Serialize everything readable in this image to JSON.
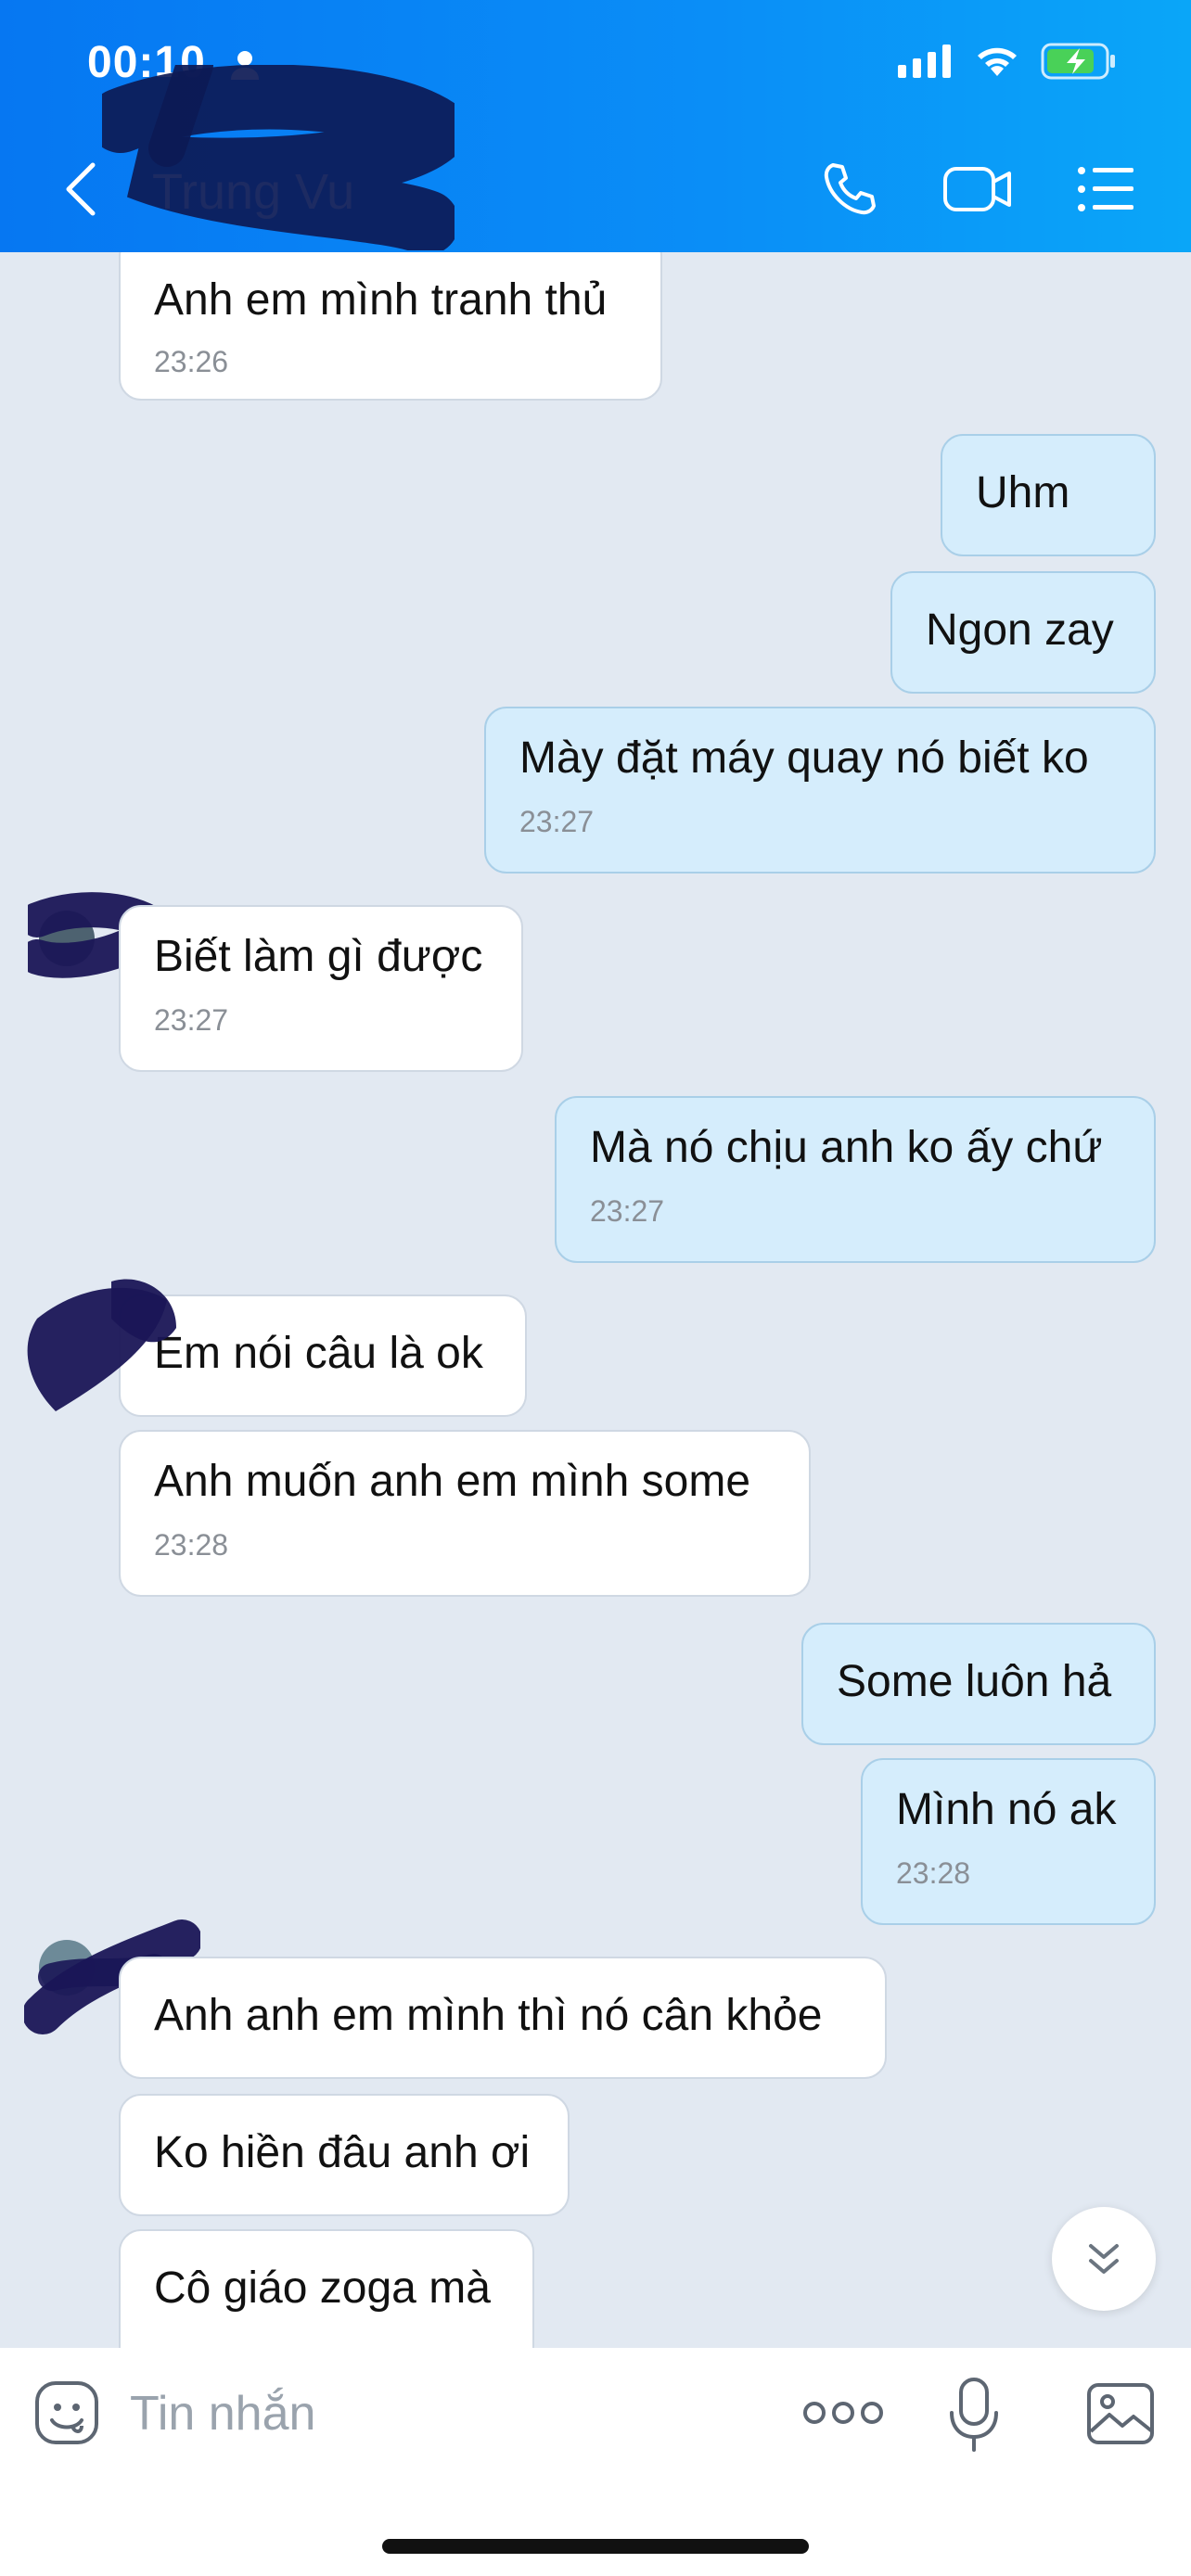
{
  "status_bar": {
    "time": "00:10"
  },
  "header": {
    "contact_name": "Trung Vu",
    "icons": [
      "back-icon",
      "phone-icon",
      "video-icon",
      "list-icon"
    ]
  },
  "messages": [
    {
      "side": "in",
      "text": "Anh em mình tranh thủ",
      "time": "23:26"
    },
    {
      "side": "out",
      "text": "Uhm",
      "time": ""
    },
    {
      "side": "out",
      "text": "Ngon zay",
      "time": ""
    },
    {
      "side": "out",
      "text": "Mày đặt máy quay nó biết ko",
      "time": "23:27"
    },
    {
      "side": "in",
      "text": "Biết làm gì được",
      "time": "23:27"
    },
    {
      "side": "out",
      "text": "Mà nó chịu anh ko ấy chứ",
      "time": "23:27"
    },
    {
      "side": "in",
      "text": "Em nói câu là ok",
      "time": ""
    },
    {
      "side": "in",
      "text": "Anh muốn anh em mình some",
      "time": "23:28"
    },
    {
      "side": "out",
      "text": "Some luôn hả",
      "time": ""
    },
    {
      "side": "out",
      "text": "Mình nó ak",
      "time": "23:28"
    },
    {
      "side": "in",
      "text": "Anh anh em mình thì nó cân khỏe",
      "time": ""
    },
    {
      "side": "in",
      "text": "Ko hiền đâu anh ơi",
      "time": ""
    },
    {
      "side": "in",
      "text": "Cô giáo zoga mà",
      "time": ""
    }
  ],
  "input": {
    "placeholder": "Tin nhắn"
  },
  "colors": {
    "header": "#0a8ef7",
    "outgoing_bubble": "#d5edfc",
    "incoming_bubble": "#ffffff",
    "chat_bg": "#e2e9f2"
  }
}
